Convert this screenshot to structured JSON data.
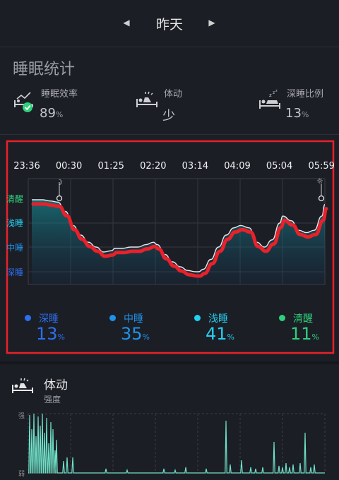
{
  "header": {
    "date": "昨天",
    "prev_icon": "chevron-left-icon",
    "next_icon": "chevron-right-icon"
  },
  "summary": {
    "title": "睡眠统计",
    "stats": [
      {
        "label": "睡眠效率",
        "value": "89",
        "unit": "%",
        "icon": "bed-check-icon"
      },
      {
        "label": "体动",
        "value": "少",
        "unit": "",
        "icon": "body-movement-icon"
      },
      {
        "label": "深睡比例",
        "value": "13",
        "unit": "%",
        "icon": "deep-sleep-icon"
      }
    ]
  },
  "sleep_chart": {
    "times": [
      "23:36",
      "00:30",
      "01:25",
      "02:20",
      "03:14",
      "04:09",
      "05:04",
      "05:59"
    ],
    "stages": [
      "清醒",
      "浅睡",
      "中睡",
      "深睡"
    ],
    "legend": [
      {
        "name": "深睡",
        "pct": "13",
        "unit": "%",
        "color": "#2c6ff0"
      },
      {
        "name": "中睡",
        "pct": "35",
        "unit": "%",
        "color": "#1e93ea"
      },
      {
        "name": "浅睡",
        "pct": "41",
        "unit": "%",
        "color": "#22d0f0"
      },
      {
        "name": "清醒",
        "pct": "11",
        "unit": "%",
        "color": "#2fd07a"
      }
    ],
    "highlight_color": "#e8212a"
  },
  "chart_data": {
    "type": "line",
    "x": [
      "23:36",
      "23:50",
      "00:00",
      "00:10",
      "00:20",
      "00:30",
      "00:40",
      "00:50",
      "01:00",
      "01:10",
      "01:20",
      "01:25",
      "01:35",
      "01:45",
      "01:55",
      "02:05",
      "02:15",
      "02:20",
      "02:30",
      "02:40",
      "02:50",
      "03:00",
      "03:10",
      "03:14",
      "03:20",
      "03:30",
      "03:40",
      "03:50",
      "04:00",
      "04:09",
      "04:20",
      "04:30",
      "04:40",
      "04:50",
      "05:00",
      "05:04",
      "05:15",
      "05:25",
      "05:35",
      "05:45",
      "05:55",
      "05:59"
    ],
    "y_categories": [
      "深睡",
      "中睡",
      "浅睡",
      "清醒"
    ],
    "series": [
      {
        "values": [
          4.0,
          4.0,
          3.95,
          3.9,
          3.5,
          2.9,
          2.5,
          2.2,
          2.0,
          1.8,
          1.85,
          1.95,
          1.95,
          2.0,
          2.0,
          2.1,
          2.2,
          2.1,
          1.7,
          1.4,
          1.2,
          1.05,
          1.0,
          1.0,
          1.1,
          1.5,
          2.0,
          2.5,
          2.8,
          2.9,
          2.8,
          2.2,
          2.0,
          2.3,
          3.0,
          3.3,
          3.1,
          2.7,
          2.6,
          2.7,
          3.3,
          3.8
        ]
      }
    ]
  },
  "body_movement": {
    "title": "体动",
    "subtitle": "强度",
    "y_top": "强",
    "y_bottom": "弱",
    "icon": "body-movement-icon"
  }
}
